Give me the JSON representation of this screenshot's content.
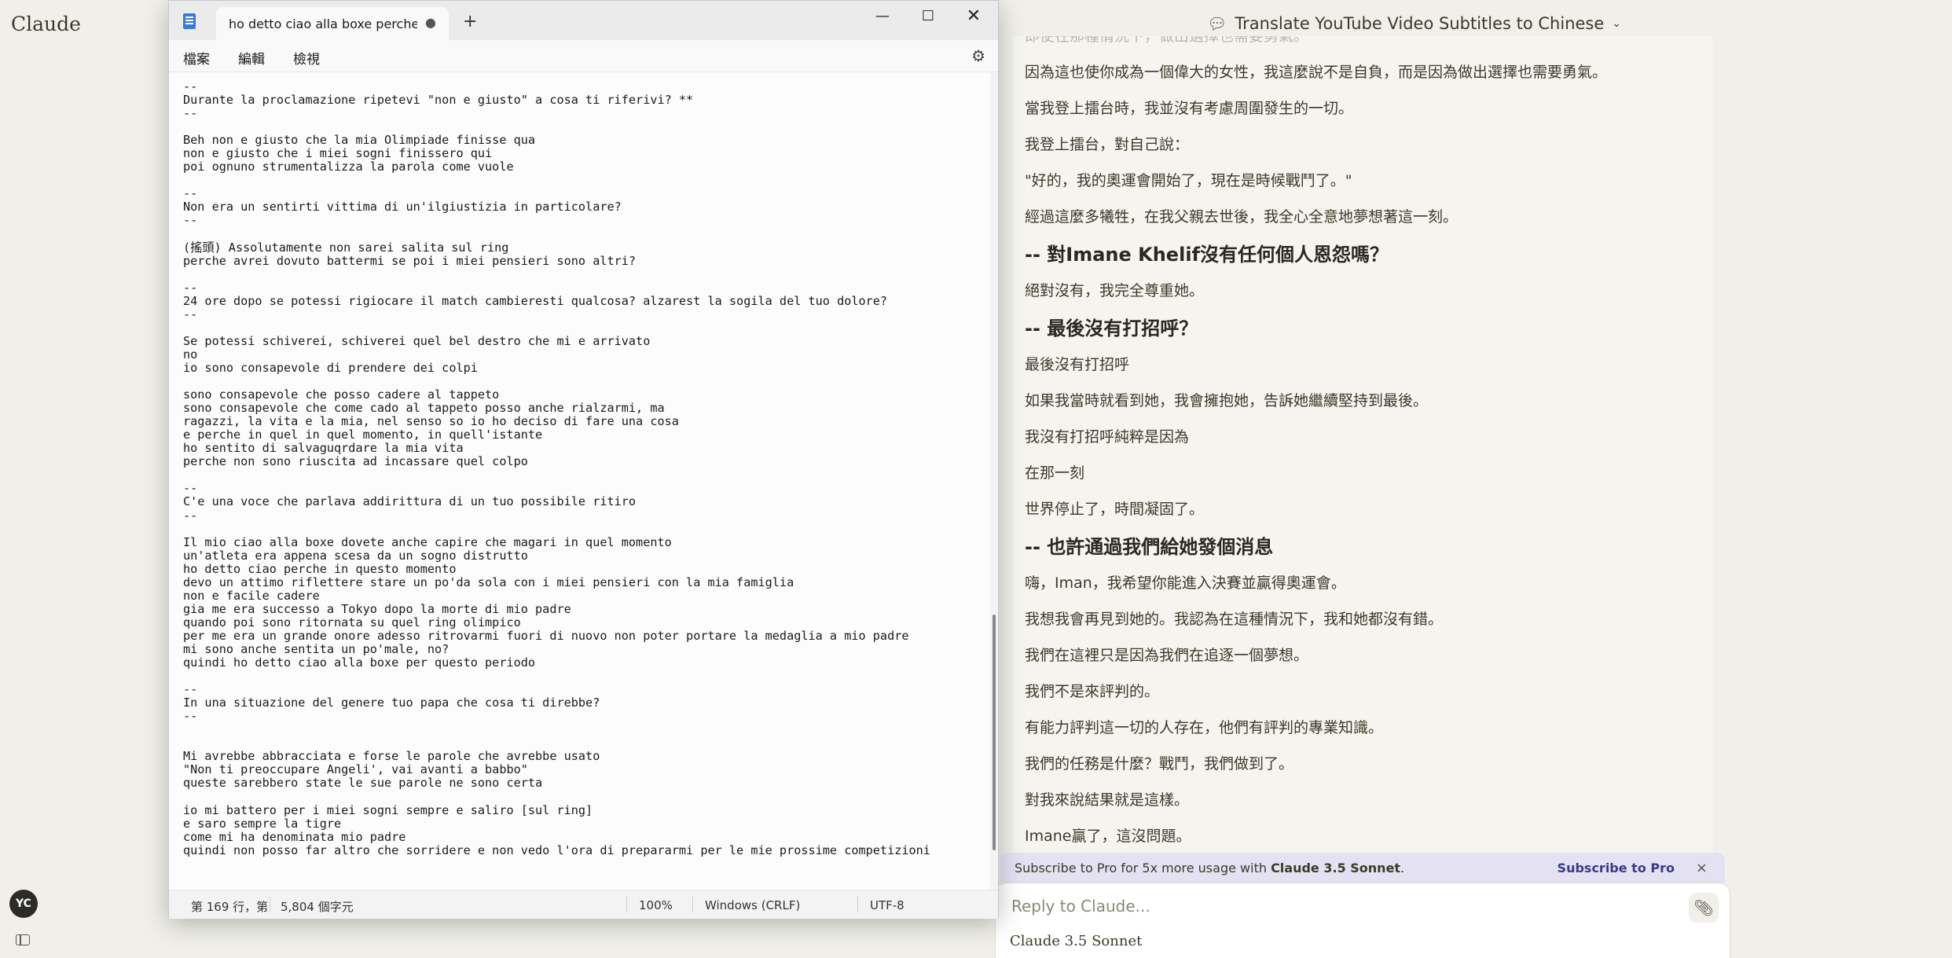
{
  "claude": {
    "logo": "Claude",
    "user_initials": "YC",
    "chat_title": "Translate YouTube Video Subtitles to Chinese",
    "messages": [
      {
        "type": "p",
        "text": "即使在那種情況下，做出選擇也需要勇氣。",
        "faded": true
      },
      {
        "type": "p",
        "text": "因為這也使你成為一個偉大的女性，我這麼說不是自負，而是因為做出選擇也需要勇氣。"
      },
      {
        "type": "p",
        "text": "當我登上擂台時，我並沒有考慮周圍發生的一切。"
      },
      {
        "type": "p",
        "text": "我登上擂台，對自己說："
      },
      {
        "type": "p",
        "text": "\"好的，我的奧運會開始了，現在是時候戰鬥了。\""
      },
      {
        "type": "p",
        "text": "經過這麼多犧牲，在我父親去世後，我全心全意地夢想著這一刻。"
      },
      {
        "type": "h",
        "text": "-- 對Imane Khelif沒有任何個人恩怨嗎？"
      },
      {
        "type": "p",
        "text": "絕對沒有，我完全尊重她。"
      },
      {
        "type": "h",
        "text": "-- 最後沒有打招呼？"
      },
      {
        "type": "p",
        "text": "最後沒有打招呼"
      },
      {
        "type": "p",
        "text": "如果我當時就看到她，我會擁抱她，告訴她繼續堅持到最後。"
      },
      {
        "type": "p",
        "text": "我沒有打招呼純粹是因為"
      },
      {
        "type": "p",
        "text": "在那一刻"
      },
      {
        "type": "p",
        "text": "世界停止了，時間凝固了。"
      },
      {
        "type": "h",
        "text": "-- 也許通過我們給她發個消息"
      },
      {
        "type": "p",
        "text": "嗨，Iman，我希望你能進入決賽並贏得奧運會。"
      },
      {
        "type": "p",
        "text": "我想我會再見到她的。我認為在這種情況下，我和她都沒有錯。"
      },
      {
        "type": "p",
        "text": "我們在這裡只是因為我們在追逐一個夢想。"
      },
      {
        "type": "p",
        "text": "我們不是來評判的。"
      },
      {
        "type": "p",
        "text": "有能力評判這一切的人存在，他們有評判的專業知識。"
      },
      {
        "type": "p",
        "text": "我們的任務是什麼？戰鬥，我們做到了。"
      },
      {
        "type": "p",
        "text": "對我來說結果就是這樣。"
      },
      {
        "type": "p",
        "text": "Imane贏了，這沒問題。"
      }
    ],
    "banner": {
      "text_prefix": "Subscribe to Pro for 5x more usage with ",
      "text_bold": "Claude 3.5 Sonnet",
      "text_suffix": ".",
      "link": "Subscribe to Pro",
      "close": "×"
    },
    "reply": {
      "placeholder": "Reply to Claude...",
      "model": "Claude 3.5 Sonnet"
    }
  },
  "notepad": {
    "tab_title": "ho detto ciao alla boxe perche in q",
    "tab_unsaved": "●",
    "new_tab": "+",
    "window_buttons": {
      "minimize": "—",
      "maximize": "☐",
      "close": "✕"
    },
    "menu": {
      "file": "檔案",
      "edit": "編輯",
      "view": "檢視"
    },
    "lines": [
      "--",
      "Durante la proclamazione ripetevi \"non e giusto\" a cosa ti riferivi? **",
      "--",
      "",
      "Beh non e giusto che la mia Olimpiade finisse qua",
      "non e giusto che i miei sogni finissero qui",
      "poi ognuno strumentalizza la parola come vuole",
      "",
      "--",
      "Non era un sentirti vittima di un'ilgiustizia in particolare?",
      "--",
      "",
      "(搖頭) Assolutamente non sarei salita sul ring",
      "perche avrei dovuto battermi se poi i miei pensieri sono altri?",
      "",
      "--",
      "24 ore dopo se potessi rigiocare il match cambieresti qualcosa? alzarest la sogila del tuo dolore?",
      "--",
      "",
      "Se potessi schiverei, schiverei quel bel destro che mi e arrivato",
      "no",
      "io sono consapevole di prendere dei colpi",
      "",
      "sono consapevole che posso cadere al tappeto",
      "sono consapevole che come cado al tappeto posso anche rialzarmi, ma",
      "ragazzi, la vita e la mia, nel senso so io ho deciso di fare una cosa",
      "e perche in quel in quel momento, in quell'istante",
      "ho sentito di salvaguqrdare la mia vita",
      "perche non sono riuscita ad incassare quel colpo",
      "",
      "--",
      "C'e una voce che parlava addirittura di un tuo possibile ritiro",
      "--",
      "",
      "Il mio ciao alla boxe dovete anche capire che magari in quel momento",
      "un'atleta era appena scesa da un sogno distrutto",
      "ho detto ciao perche in questo momento",
      "devo un attimo riflettere stare un po'da sola con i miei pensieri con la mia famiglia",
      "non e facile cadere",
      "gia me era successo a Tokyo dopo la morte di mio padre",
      "quando poi sono ritornata su quel ring olimpico",
      "per me era un grande onore adesso ritrovarmi fuori di nuovo non poter portare la medaglia a mio padre",
      "mi sono anche sentita un po'male, no?",
      "quindi ho detto ciao alla boxe per questo periodo",
      "",
      "--",
      "In una situazione del genere tuo papa che cosa ti direbbe?",
      "--",
      "",
      "",
      "Mi avrebbe abbracciata e forse le parole che avrebbe usato",
      "\"Non ti preoccupare Angeli', vai avanti a babbo\"",
      "queste sarebbero state le sue parole ne sono certa",
      "",
      "io mi battero per i miei sogni sempre e saliro [sul ring]",
      "e saro sempre la tigre",
      "come mi ha denominata mio padre",
      "quindi non posso far altro che sorridere e non vedo l'ora di prepararmi per le mie prossime competizioni"
    ],
    "status": {
      "position": "第 169 行，第",
      "chars": "5,804 個字元",
      "zoom": "100%",
      "line_ending": "Windows (CRLF)",
      "encoding": "UTF-8"
    }
  }
}
